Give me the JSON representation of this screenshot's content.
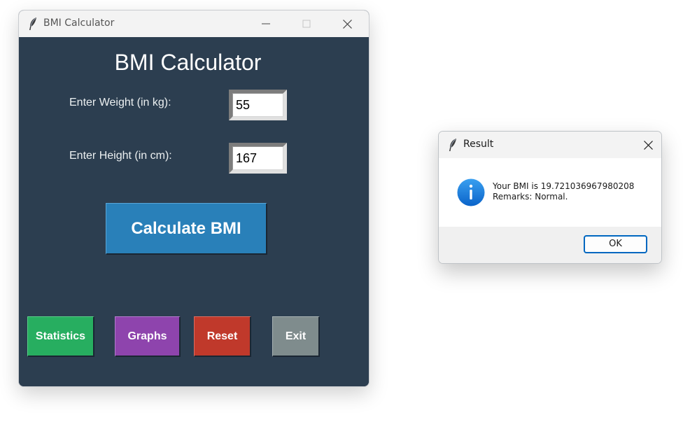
{
  "main_window": {
    "title": "BMI Calculator",
    "heading": "BMI Calculator",
    "weight": {
      "label": "Enter Weight (in kg):",
      "value": "55"
    },
    "height": {
      "label": "Enter Height (in cm):",
      "value": "167"
    },
    "calculate_label": "Calculate BMI",
    "actions": {
      "statistics": "Statistics",
      "graphs": "Graphs",
      "reset": "Reset",
      "exit": "Exit"
    },
    "colors": {
      "background": "#2c3e50",
      "calculate": "#2980b9",
      "statistics": "#27ae60",
      "graphs": "#8e44ad",
      "reset": "#c0392b",
      "exit": "#7f8c8d"
    }
  },
  "dialog": {
    "title": "Result",
    "message_line1": "Your BMI is 19.721036967980208",
    "message_line2": "Remarks: Normal.",
    "ok_label": "OK",
    "icon": "info-icon"
  }
}
